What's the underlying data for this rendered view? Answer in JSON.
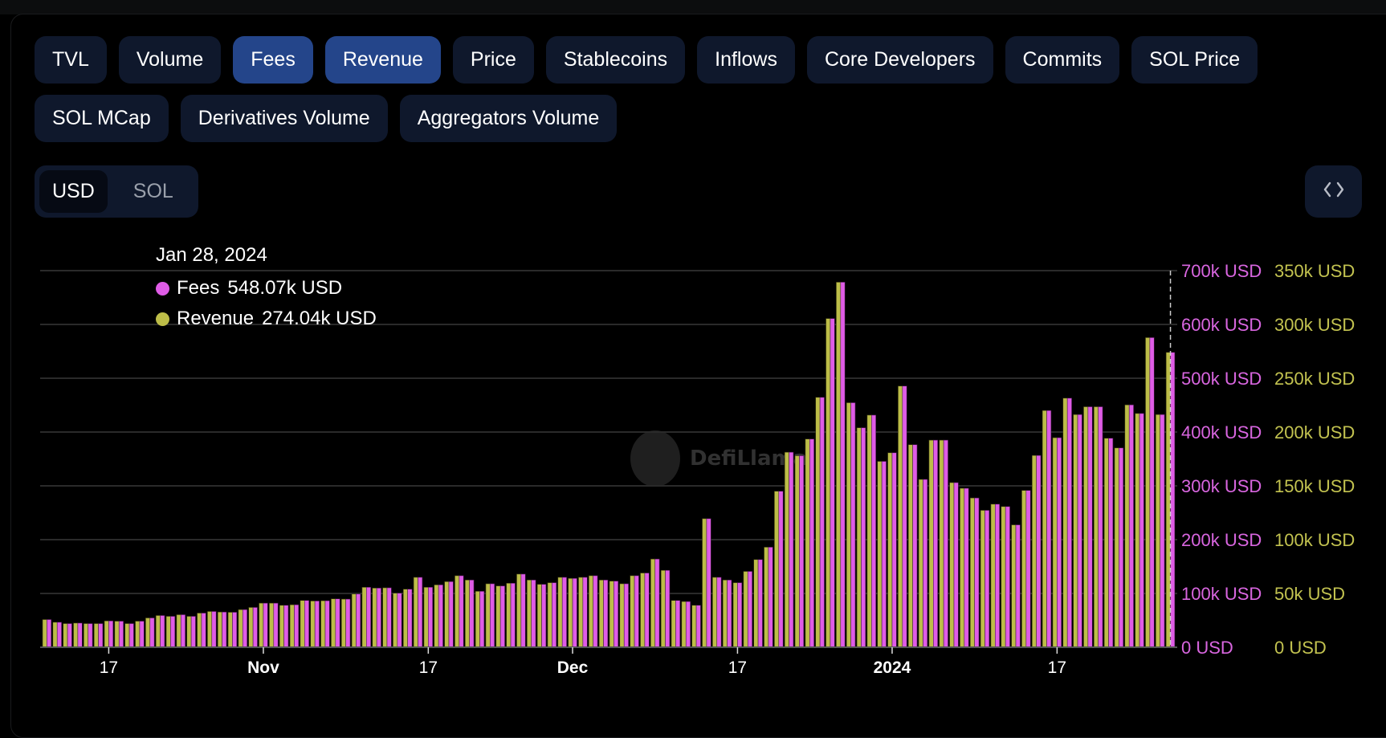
{
  "tabs": [
    {
      "label": "TVL",
      "active": false
    },
    {
      "label": "Volume",
      "active": false
    },
    {
      "label": "Fees",
      "active": true
    },
    {
      "label": "Revenue",
      "active": true
    },
    {
      "label": "Price",
      "active": false
    },
    {
      "label": "Stablecoins",
      "active": false
    },
    {
      "label": "Inflows",
      "active": false
    },
    {
      "label": "Core Developers",
      "active": false
    },
    {
      "label": "Commits",
      "active": false
    },
    {
      "label": "SOL Price",
      "active": false
    },
    {
      "label": "SOL MCap",
      "active": false
    },
    {
      "label": "Derivatives Volume",
      "active": false
    },
    {
      "label": "Aggregators Volume",
      "active": false
    }
  ],
  "denomination": {
    "options": [
      "USD",
      "SOL"
    ],
    "selected": "USD"
  },
  "embed_button": {
    "icon": "code-icon"
  },
  "tooltip": {
    "date": "Jan 28, 2024",
    "rows": [
      {
        "name": "Fees",
        "value": "548.07k USD",
        "color": "#df5ce6"
      },
      {
        "name": "Revenue",
        "value": "274.04k USD",
        "color": "#bdbd48"
      }
    ]
  },
  "watermark": "DefiLlama",
  "chart_data": {
    "type": "bar",
    "title": "",
    "xlabel": "",
    "ylabel": "",
    "x_start": "2023-10-11",
    "x_end": "2024-01-28",
    "x_ticks": [
      {
        "label": "17",
        "date": "2023-10-17",
        "bold": false
      },
      {
        "label": "Nov",
        "date": "2023-11-01",
        "bold": true
      },
      {
        "label": "17",
        "date": "2023-11-17",
        "bold": false
      },
      {
        "label": "Dec",
        "date": "2023-12-01",
        "bold": true
      },
      {
        "label": "17",
        "date": "2023-12-17",
        "bold": false
      },
      {
        "label": "2024",
        "date": "2024-01-01",
        "bold": true
      },
      {
        "label": "17",
        "date": "2024-01-17",
        "bold": false
      }
    ],
    "y_axes": [
      {
        "series": "Fees",
        "range": [
          0,
          700000
        ],
        "ticks": [
          "0 USD",
          "100k USD",
          "200k USD",
          "300k USD",
          "400k USD",
          "500k USD",
          "600k USD",
          "700k USD"
        ],
        "color": "#d966e0"
      },
      {
        "series": "Revenue",
        "range": [
          0,
          350000
        ],
        "ticks": [
          "0 USD",
          "50k USD",
          "100k USD",
          "150k USD",
          "200k USD",
          "250k USD",
          "300k USD",
          "350k USD"
        ],
        "color": "#c3c350"
      }
    ],
    "grid": true,
    "legend": "none",
    "highlight_date": "2024-01-28",
    "series": [
      {
        "name": "Revenue",
        "color": "#bdbd48",
        "axis": 1,
        "values": [
          25750,
          23250,
          22000,
          22500,
          22000,
          22000,
          24500,
          24250,
          22000,
          24250,
          27250,
          29500,
          28750,
          30250,
          28750,
          31750,
          33250,
          32750,
          32500,
          35000,
          37000,
          41000,
          41000,
          39000,
          39500,
          43500,
          43000,
          43250,
          45000,
          44750,
          49500,
          55750,
          55000,
          55250,
          50250,
          54000,
          65000,
          55750,
          58000,
          61000,
          66500,
          62500,
          52000,
          59000,
          57000,
          59500,
          68000,
          62500,
          58500,
          60000,
          65000,
          64000,
          65000,
          66500,
          62500,
          61500,
          59000,
          66500,
          69000,
          82000,
          71500,
          43500,
          42500,
          39000,
          119500,
          65000,
          62500,
          60000,
          70500,
          81500,
          93000,
          145000,
          181250,
          178000,
          193500,
          232250,
          305500,
          339250,
          227250,
          204000,
          215750,
          172750,
          180750,
          242750,
          188250,
          156000,
          192500,
          192500,
          153000,
          147750,
          138750,
          127250,
          133000,
          130750,
          113750,
          145750,
          178250,
          220000,
          194750,
          231500,
          216250,
          223500,
          223500,
          194250,
          185250,
          225250,
          217250,
          287750,
          216250,
          274040
        ]
      },
      {
        "name": "Fees",
        "color": "#df5ce6",
        "axis": 0,
        "values": [
          51500,
          46500,
          44000,
          45000,
          44000,
          44000,
          49000,
          48500,
          44000,
          48500,
          54500,
          59000,
          57500,
          60500,
          57500,
          63500,
          66500,
          65500,
          65000,
          70000,
          74000,
          82000,
          82000,
          78000,
          79000,
          87000,
          86000,
          86500,
          90000,
          89500,
          99000,
          111500,
          110000,
          110500,
          100500,
          108000,
          130000,
          111500,
          116000,
          122000,
          133000,
          125000,
          104000,
          118000,
          114000,
          119000,
          136000,
          125000,
          117000,
          120000,
          130000,
          128000,
          130000,
          133000,
          125000,
          123000,
          118000,
          133000,
          138000,
          164000,
          143000,
          87000,
          85000,
          78000,
          239000,
          130000,
          125000,
          120000,
          141000,
          163000,
          186000,
          290000,
          362500,
          356000,
          387000,
          464500,
          611000,
          678500,
          454500,
          408000,
          431500,
          345500,
          361500,
          485500,
          376500,
          312000,
          385000,
          385000,
          306000,
          295500,
          277500,
          254500,
          266000,
          261500,
          227500,
          291500,
          356500,
          440000,
          389500,
          463000,
          432500,
          447000,
          447000,
          388500,
          370500,
          450500,
          434500,
          575500,
          432500,
          548070
        ]
      }
    ]
  }
}
